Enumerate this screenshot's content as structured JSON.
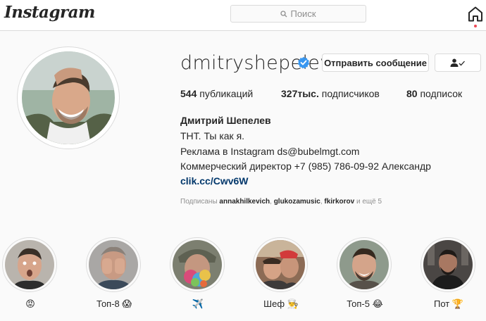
{
  "nav": {
    "logo": "Instagram",
    "search_placeholder": "Поиск"
  },
  "profile": {
    "username": "dmitryshepelev",
    "message_button": "Отправить сообщение",
    "stats": {
      "posts_count": "544",
      "posts_label": "публикаций",
      "followers_count": "327тыс.",
      "followers_label": "подписчиков",
      "following_count": "80",
      "following_label": "подписок"
    },
    "full_name": "Дмитрий Шепелев",
    "bio": [
      "ТНТ. Ты как я.",
      "Реклама в Instagram ds@bubelmgt.com",
      "Коммерческий директор +7 (985) 786-09-92 Александр"
    ],
    "link": "clik.cc/Cwv6W",
    "followed_by": {
      "prefix": "Подписаны",
      "users": [
        "annakhilkevich",
        "glukozamusic",
        "fkirkorov"
      ],
      "suffix": "и ещё 5"
    }
  },
  "highlights": [
    {
      "label": "😡"
    },
    {
      "label": "Топ-8 😱"
    },
    {
      "label": "✈️"
    },
    {
      "label": "Шеф 👨‍🍳"
    },
    {
      "label": "Топ-5 😂"
    },
    {
      "label": "Пот 🏆"
    }
  ],
  "colors": {
    "accent": "#0095f6",
    "link": "#00376b",
    "verified": "#3897f0",
    "notification": "#ed4956"
  },
  "icons": [
    "search-icon",
    "home-icon",
    "verified-badge-icon",
    "following-check-icon"
  ]
}
